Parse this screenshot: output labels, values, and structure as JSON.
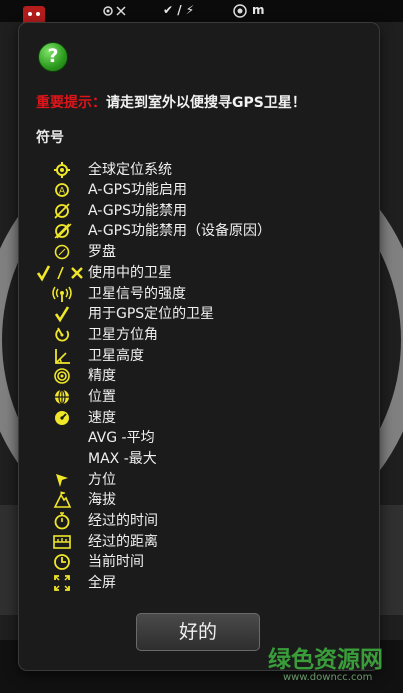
{
  "statusbar": {
    "gps_indicator": "✔ / ⚡",
    "right_text": "m"
  },
  "dialog": {
    "warning_red": "重要提示：",
    "warning_text": "请走到室外以便搜寻GPS卫星！",
    "symbols_heading": "符号",
    "ok_label": "好的",
    "question_icon_text": "?",
    "items": [
      {
        "icon": "gps-target-icon",
        "label": "全球定位系统"
      },
      {
        "icon": "agps-enabled-icon",
        "label": "A-GPS功能启用"
      },
      {
        "icon": "agps-disabled-icon",
        "label": "A-GPS功能禁用"
      },
      {
        "icon": "agps-disabled-device-icon",
        "label": "A-GPS功能禁用（设备原因）"
      },
      {
        "icon": "compass-icon",
        "label": "罗盘"
      },
      {
        "icon": "satellite-in-use-icon",
        "label": "使用中的卫星"
      },
      {
        "icon": "signal-strength-icon",
        "label": "卫星信号的强度"
      },
      {
        "icon": "checkmark-icon",
        "label": "用于GPS定位的卫星"
      },
      {
        "icon": "azimuth-icon",
        "label": "卫星方位角"
      },
      {
        "icon": "elevation-icon",
        "label": "卫星高度"
      },
      {
        "icon": "accuracy-icon",
        "label": "精度"
      },
      {
        "icon": "globe-icon",
        "label": "位置"
      },
      {
        "icon": "speedometer-icon",
        "label": "速度"
      },
      {
        "icon": "",
        "label": "AVG -平均"
      },
      {
        "icon": "",
        "label": "MAX -最大"
      },
      {
        "icon": "bearing-icon",
        "label": "方位"
      },
      {
        "icon": "altitude-icon",
        "label": "海拔"
      },
      {
        "icon": "stopwatch-icon",
        "label": "经过的时间"
      },
      {
        "icon": "ruler-icon",
        "label": "经过的距离"
      },
      {
        "icon": "clock-icon",
        "label": "当前时间"
      },
      {
        "icon": "fullscreen-icon",
        "label": "全屏"
      }
    ]
  },
  "watermark": {
    "text": "绿色资源网",
    "sub": "www.downcc.com"
  }
}
